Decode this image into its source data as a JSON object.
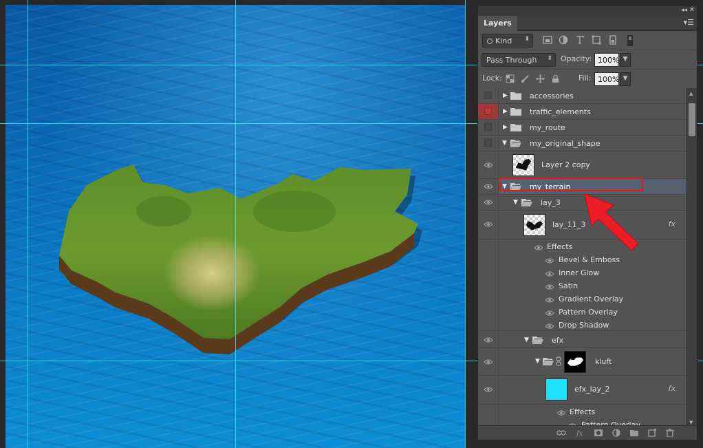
{
  "panel": {
    "tab": "Layers",
    "filter_kind": "Kind",
    "blend_mode": "Pass Through",
    "opacity_label": "Opacity:",
    "opacity_value": "100%",
    "lock_label": "Lock:",
    "fill_label": "Fill:",
    "fill_value": "100%"
  },
  "layers": {
    "accessories": "accessories",
    "traffic_elements": "traffic_elements",
    "my_route": "my_route",
    "my_original_shape": "my_original_shape",
    "layer2copy": "Layer 2 copy",
    "my_terrain": "my_terrain",
    "lay_3": "lay_3",
    "lay_11_3": "lay_11_3",
    "effects_label": "Effects",
    "effects_lay_11_3": [
      "Bevel & Emboss",
      "Inner Glow",
      "Satin",
      "Gradient Overlay",
      "Pattern Overlay",
      "Drop Shadow"
    ],
    "efx": "efx",
    "kluft": "kluft",
    "efx_lay_2": "efx_lay_2",
    "effects_efx_lay_2": [
      "Pattern Overlay"
    ],
    "fx_badge": "fx"
  },
  "colors": {
    "panel_bg": "#535353",
    "selected_row": "#56606e",
    "highlight_red": "#e01b1b",
    "guide": "#35e6f5",
    "efx_swatch": "#1fe0ff",
    "traffic_vis": "#c0393b"
  },
  "icons": {
    "pixel_filter": "image-icon",
    "adjustment_filter": "half-circle-icon",
    "type_filter": "type-icon",
    "shape_filter": "shape-icon",
    "smart_filter": "smart-object-icon",
    "link": "link-icon",
    "new_layer": "new-layer-icon",
    "delete": "trash-icon"
  }
}
